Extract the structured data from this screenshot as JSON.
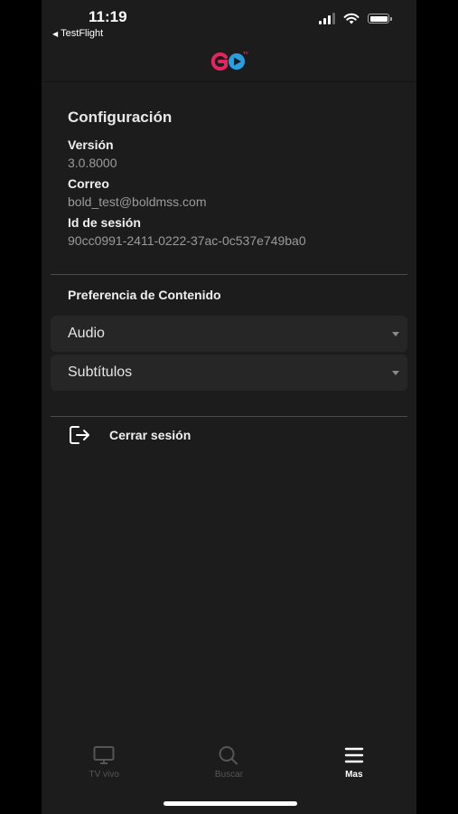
{
  "status_bar": {
    "time": "11:19",
    "back_app": "TestFlight"
  },
  "header": {
    "logo_text": "GO",
    "logo_badge": "TV",
    "colors": {
      "pink": "#e6245f",
      "blue": "#2a9fe0"
    }
  },
  "config": {
    "title": "Configuración",
    "fields": [
      {
        "label": "Versión",
        "value": "3.0.8000"
      },
      {
        "label": "Correo",
        "value": "bold_test@boldmss.com"
      },
      {
        "label": "Id de sesión",
        "value": "90cc0991-2411-0222-37ac-0c537e749ba0"
      }
    ]
  },
  "preferences": {
    "title": "Preferencia de Contenido",
    "audio": "Audio",
    "subtitles": "Subtítulos"
  },
  "logout": {
    "label": "Cerrar sesión",
    "icon": "logout-icon"
  },
  "tabbar": {
    "tabs": [
      {
        "label": "TV vivo",
        "icon": "tv-icon",
        "active": false
      },
      {
        "label": "Buscar",
        "icon": "search-icon",
        "active": false
      },
      {
        "label": "Mas",
        "icon": "menu-icon",
        "active": true
      }
    ]
  }
}
